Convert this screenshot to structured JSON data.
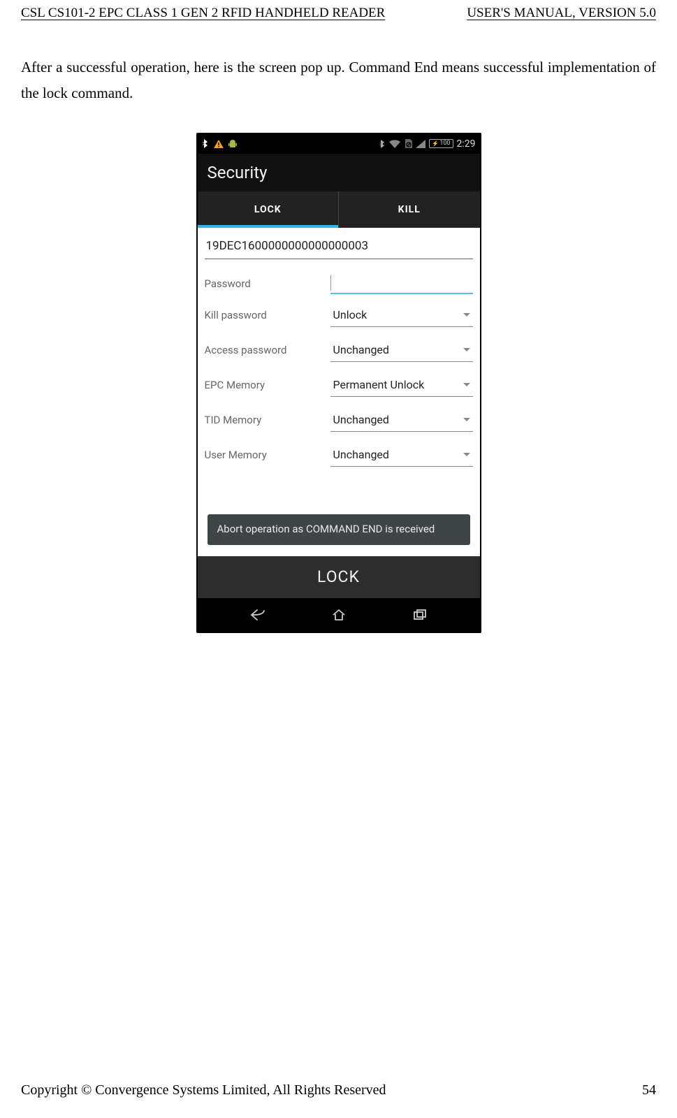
{
  "header": {
    "left": "CSL CS101-2 EPC CLASS 1 GEN 2 RFID HANDHELD READER",
    "right": "USER'S  MANUAL,  VERSION  5.0"
  },
  "intro": "After a successful operation, here is the screen pop up.   Command End means successful implementation of the lock command.",
  "statusbar": {
    "time": "2:29",
    "battery": "100"
  },
  "actionbar": {
    "title": "Security"
  },
  "tabs": [
    {
      "label": "LOCK",
      "active": true
    },
    {
      "label": "KILL",
      "active": false
    }
  ],
  "form": {
    "epc": "19DEC1600000000000000003",
    "password_label": "Password",
    "rows": [
      {
        "label": "Kill password",
        "value": "Unlock"
      },
      {
        "label": "Access password",
        "value": "Unchanged"
      },
      {
        "label": "EPC Memory",
        "value": "Permanent Unlock"
      },
      {
        "label": "TID Memory",
        "value": "Unchanged"
      },
      {
        "label": "User Memory",
        "value": "Unchanged"
      }
    ]
  },
  "toast": "Abort operation as COMMAND END is received",
  "lock_button": "LOCK",
  "footer": {
    "copyright": "Copyright © Convergence Systems Limited, All Rights Reserved",
    "page": "54"
  }
}
